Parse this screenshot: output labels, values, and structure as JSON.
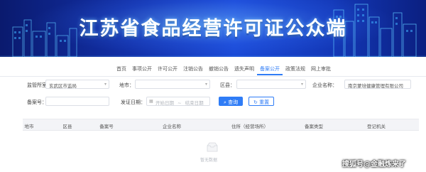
{
  "banner": {
    "title": "江苏省食品经营许可证公众端"
  },
  "nav": {
    "items": [
      {
        "label": "首页",
        "active": false
      },
      {
        "label": "事项公开",
        "active": false
      },
      {
        "label": "许可公开",
        "active": false
      },
      {
        "label": "注销公告",
        "active": false
      },
      {
        "label": "撤销公告",
        "active": false
      },
      {
        "label": "遗失声明",
        "active": false
      },
      {
        "label": "备案公开",
        "active": true
      },
      {
        "label": "政策法规",
        "active": false
      },
      {
        "label": "网上审批",
        "active": false
      }
    ]
  },
  "filters": {
    "agency_label": "监管所室：",
    "agency_value": "玄武区市监局",
    "city_label": "地市：",
    "district_label": "区县：",
    "company_label": "企业名称：",
    "company_value": "南京蒙培健康管理有限公司",
    "record_label": "备案号：",
    "date_label": "发证日期：",
    "date_start_placeholder": "开始日期",
    "date_sep": "~",
    "date_end_placeholder": "结束日期",
    "search_button": "查询",
    "reset_button": "重置"
  },
  "table": {
    "columns": [
      "地市",
      "区县",
      "备案号",
      "企业名称",
      "住所（经营场所）",
      "备案类型",
      "登记机关"
    ]
  },
  "empty_state": {
    "text": "暂无数据"
  },
  "watermark": {
    "text": "搜狐号@金融炼来了"
  },
  "colors": {
    "accent": "#2f7cf6",
    "banner_dark": "#0a1a6e",
    "banner_light": "#1a49d6"
  }
}
